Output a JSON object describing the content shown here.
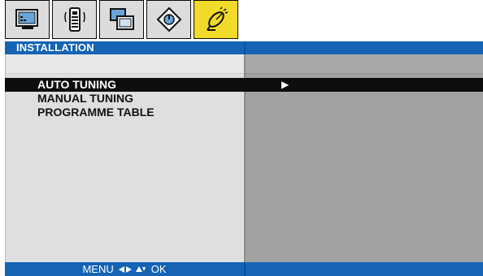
{
  "tabs": [
    {
      "icon": "tv-picture-icon",
      "active": false
    },
    {
      "icon": "sound-remote-icon",
      "active": false
    },
    {
      "icon": "windows-features-icon",
      "active": false
    },
    {
      "icon": "settings-dial-icon",
      "active": false
    },
    {
      "icon": "satellite-installation-icon",
      "active": true
    }
  ],
  "title": "INSTALLATION",
  "menu": {
    "items": [
      {
        "label": "AUTO TUNING",
        "selected": true,
        "arrow": "▶"
      },
      {
        "label": "MANUAL TUNING",
        "selected": false
      },
      {
        "label": "PROGRAMME TABLE",
        "selected": false
      }
    ]
  },
  "footer": {
    "menu_label": "MENU",
    "ok_label": "OK",
    "nav_icon": "arrows-left-right-up-down-icon"
  },
  "colors": {
    "accent_blue": "#1463b5",
    "active_tab_yellow": "#f2da2a",
    "left_panel": "#dfdfdf",
    "right_panel": "#a2a2a2",
    "selection_bar": "#0d0d0d"
  }
}
